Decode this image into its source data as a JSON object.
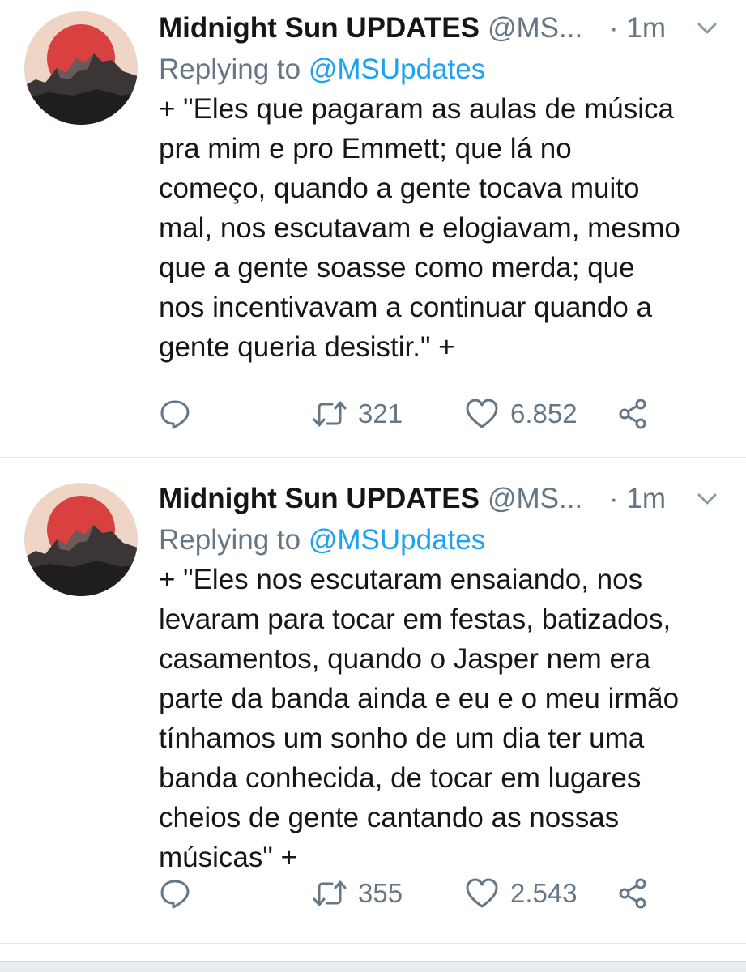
{
  "tweets": [
    {
      "display_name": "Midnight Sun UPDATES",
      "handle": "@MS...",
      "time": "· 1m",
      "replying_prefix": "Replying to",
      "replying_to": "@MSUpdates",
      "text": "+ \"Eles que pagaram as aulas de música\npra mim e pro Emmett; que lá no\ncomeço, quando a gente tocava muito\nmal, nos escutavam e elogiavam, mesmo\nque a gente soasse como merda; que\nnos incentivavam a continuar quando a\ngente queria desistir.\" +",
      "retweets": "321",
      "likes": "6.852"
    },
    {
      "display_name": "Midnight Sun UPDATES",
      "handle": "@MS...",
      "time": "· 1m",
      "replying_prefix": "Replying to",
      "replying_to": "@MSUpdates",
      "text": "+ \"Eles nos escutaram ensaiando, nos\nlevaram para tocar em festas, batizados,\ncasamentos, quando o Jasper nem era\nparte da banda ainda e eu e o meu irmão\ntínhamos um sonho de um dia ter uma\nbanda conhecida, de tocar em lugares\ncheios de gente cantando as nossas\nmúsicas\" +",
      "retweets": "355",
      "likes": "2.543"
    }
  ],
  "colors": {
    "text": "#14171a",
    "secondary": "#657786",
    "link": "#1da1f2",
    "divider": "#e1e8ed",
    "avatar_bg": "#eed5c6",
    "avatar_sun": "#d8413f"
  },
  "icons": {
    "reply": "reply-icon",
    "retweet": "retweet-icon",
    "like": "heart-icon",
    "share": "share-icon",
    "more": "chevron-down-icon"
  }
}
